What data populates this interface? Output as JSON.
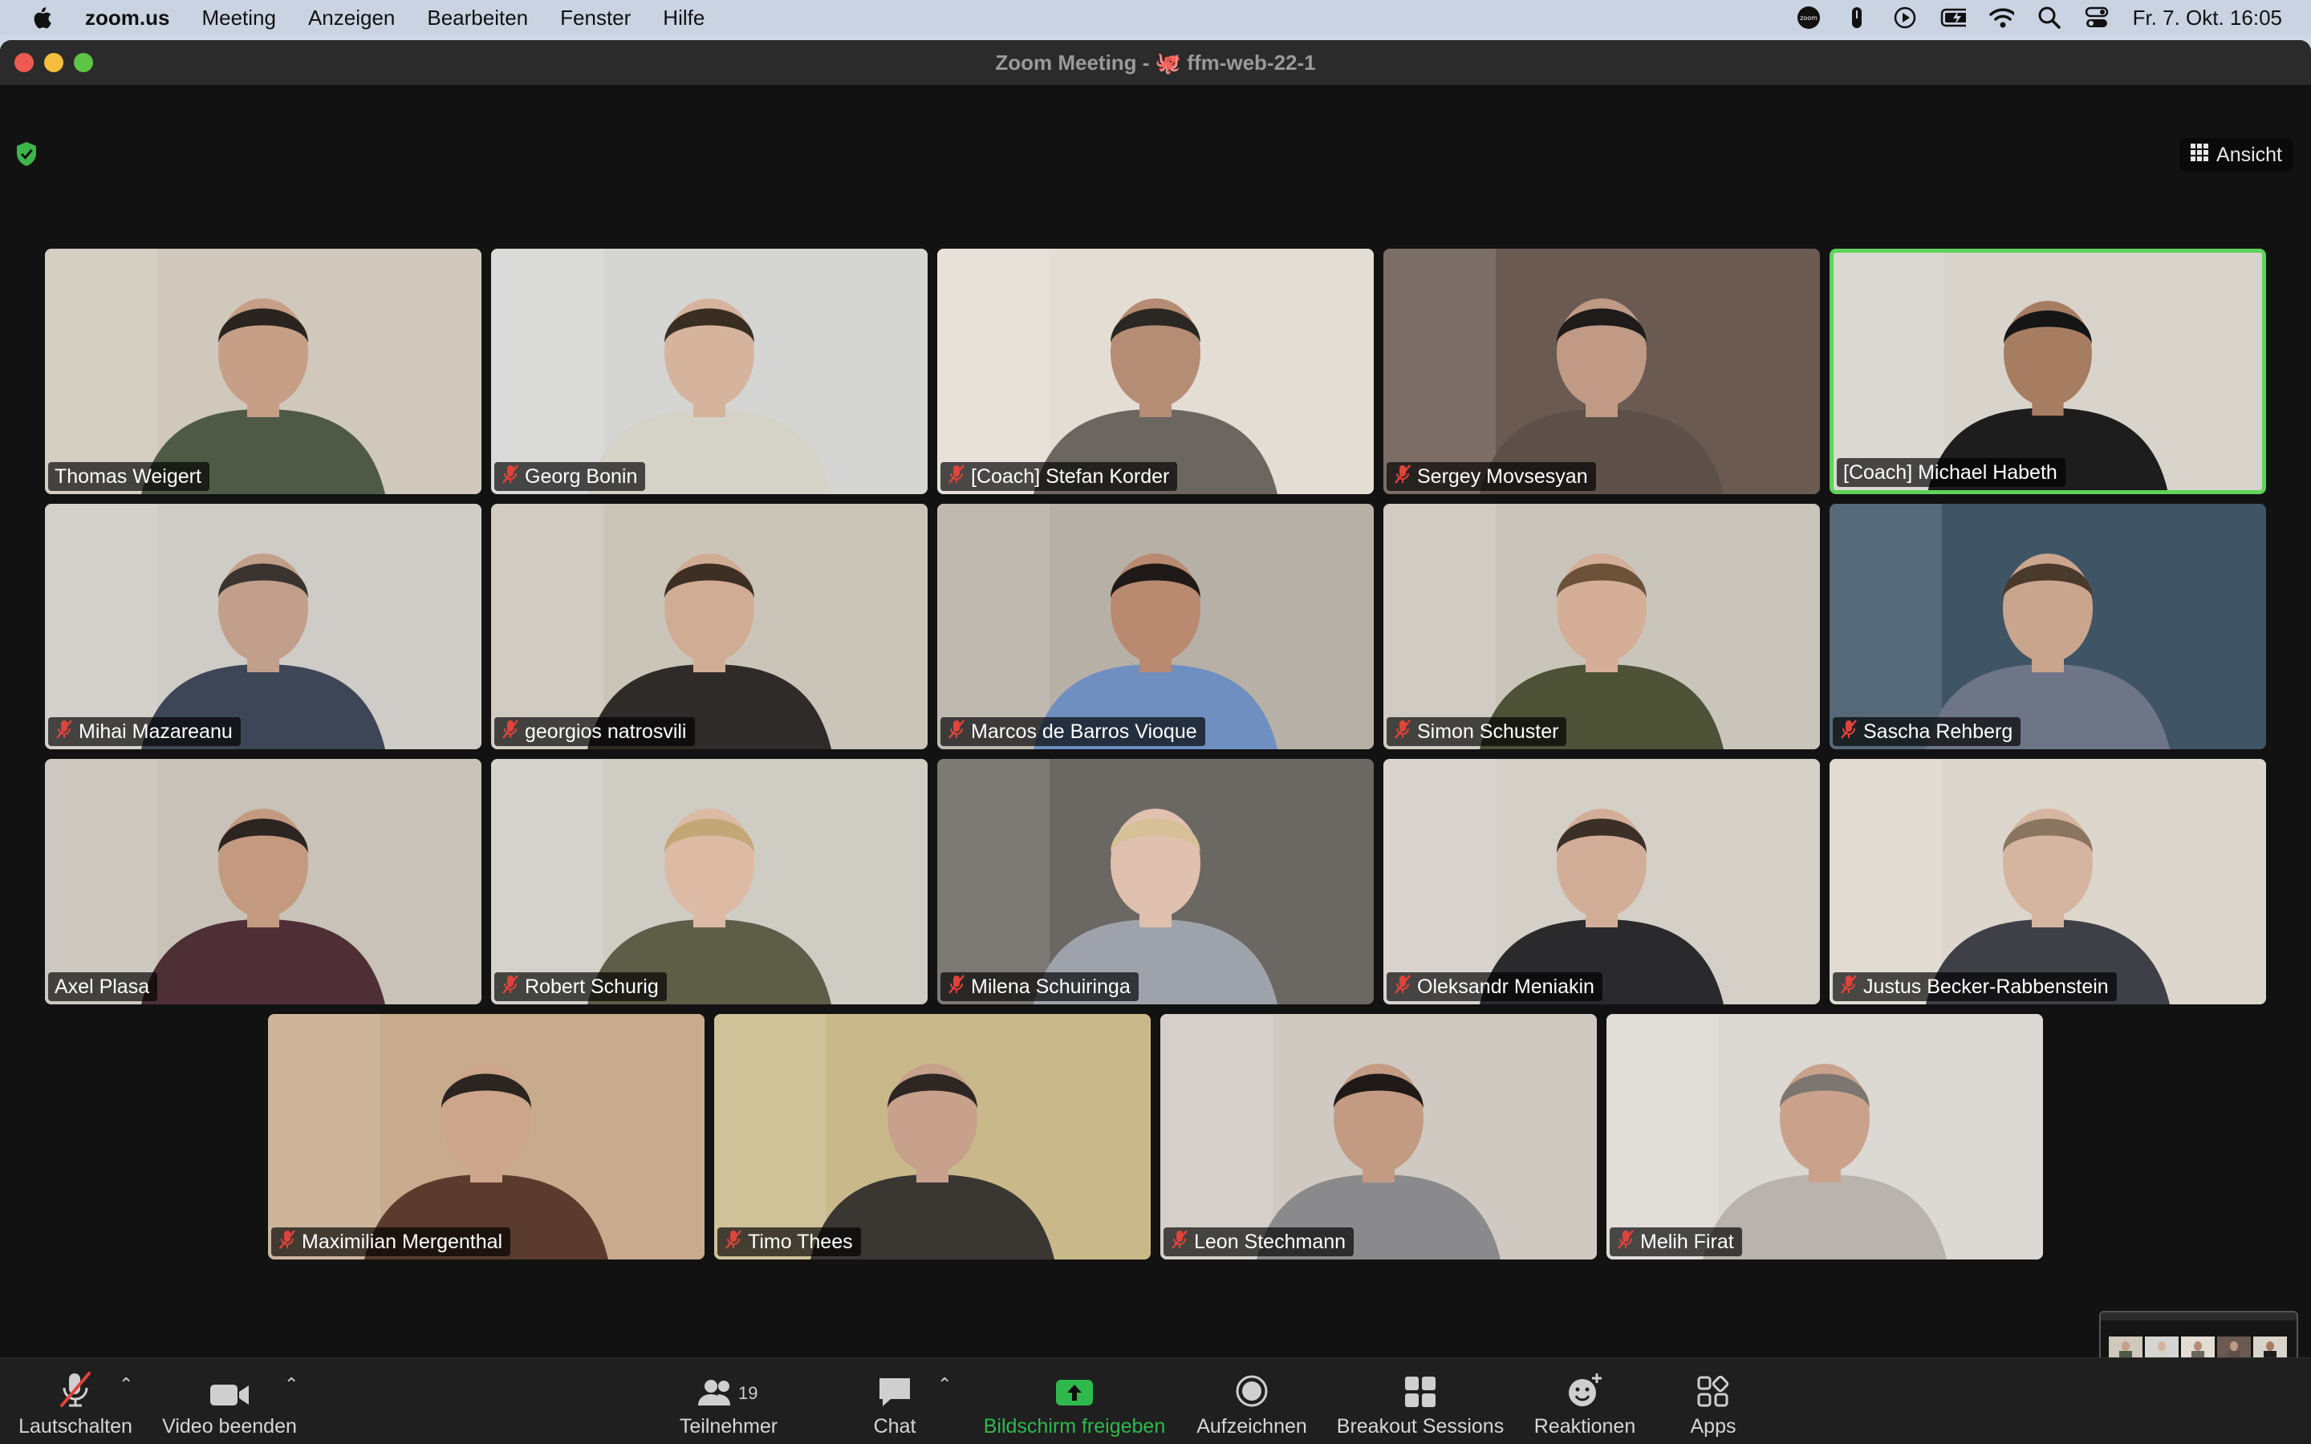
{
  "menubar": {
    "app_name": "zoom.us",
    "menus": [
      "Meeting",
      "Anzeigen",
      "Bearbeiten",
      "Fenster",
      "Hilfe"
    ],
    "clock": "Fr. 7. Okt. 16:05",
    "status_icons": [
      "zoom-status-icon",
      "gpu-icon",
      "play-icon",
      "battery-icon",
      "wifi-icon",
      "spotlight-search-icon",
      "control-center-icon"
    ]
  },
  "window": {
    "title_prefix": "Zoom Meeting - ",
    "title_emoji": "🐙",
    "title_name": "ffm-web-22-1"
  },
  "view_button": {
    "label": "Ansicht"
  },
  "colors": {
    "active_speaker_border": "#5fd35a",
    "share_green": "#2fb94d",
    "mute_red": "#e0433a"
  },
  "participants": [
    {
      "name": "Thomas Weigert",
      "muted": false,
      "bg": "#cfc8bb",
      "skin": "#c79f86",
      "shirt": "#4e5a45",
      "hair": "#2a2420"
    },
    {
      "name": "Georg Bonin",
      "muted": true,
      "bg": "#d5d5d3",
      "skin": "#d6b39c",
      "shirt": "#d5d2c7",
      "hair": "#3a2d22"
    },
    {
      "name": "[Coach] Stefan Korder",
      "muted": true,
      "bg": "#e4ddd4",
      "skin": "#b58c74",
      "shirt": "#6c6660",
      "hair": "#2b2722"
    },
    {
      "name": "Sergey Movsesyan",
      "muted": true,
      "bg": "#6a5a52",
      "skin": "#c09a85",
      "shirt": "#5c5048",
      "hair": "#1e1b1a"
    },
    {
      "name": "[Coach] Michael Habeth",
      "muted": false,
      "bg": "#d8d4cc",
      "skin": "#a77d62",
      "shirt": "#1d1d1d",
      "hair": "#151515"
    },
    {
      "name": "Mihai Mazareanu",
      "muted": true,
      "bg": "#cfcbc6",
      "skin": "#c29f8a",
      "shirt": "#3d4656",
      "hair": "#3a3330"
    },
    {
      "name": "georgios natrosvili",
      "muted": true,
      "bg": "#cbc4b9",
      "skin": "#d1ac94",
      "shirt": "#2f2b29",
      "hair": "#3e2f25"
    },
    {
      "name": "Marcos de Barros Vioque",
      "muted": true,
      "bg": "#b7b0a7",
      "skin": "#b98a70",
      "shirt": "#6f8fc0",
      "hair": "#1f1a17"
    },
    {
      "name": "Simon Schuster",
      "muted": true,
      "bg": "#cac5bb",
      "skin": "#d5ae98",
      "shirt": "#4d5237",
      "hair": "#6b5238"
    },
    {
      "name": "Sascha Rehberg",
      "muted": true,
      "bg": "#3f5566",
      "skin": "#caa58e",
      "shirt": "#6d7586",
      "hair": "#4a3a2c"
    },
    {
      "name": "Axel Plasa",
      "muted": false,
      "bg": "#c8c2b8",
      "skin": "#c39a80",
      "shirt": "#4e2f36",
      "hair": "#2c2420"
    },
    {
      "name": "Robert Schurig",
      "muted": true,
      "bg": "#cfccc4",
      "skin": "#ddbaa4",
      "shirt": "#5e5e48",
      "hair": "#c4a776"
    },
    {
      "name": "Milena Schuiringa",
      "muted": true,
      "bg": "#6b6762",
      "skin": "#e0c0ae",
      "shirt": "#9ea3ab",
      "hair": "#d6c097"
    },
    {
      "name": "Oleksandr Meniakin",
      "muted": true,
      "bg": "#d4cfc7",
      "skin": "#d2ae98",
      "shirt": "#2a2a2d",
      "hair": "#3b2f27"
    },
    {
      "name": "Justus Becker-Rabbenstein",
      "muted": true,
      "bg": "#ddd6cc",
      "skin": "#d6b5a0",
      "shirt": "#3f4047",
      "hair": "#8a7560"
    },
    {
      "name": "Maximilian Mergenthal",
      "muted": true,
      "bg": "#c8ab8c",
      "skin": "#cca58a",
      "shirt": "#5a3b2e",
      "hair": "#2b2420"
    },
    {
      "name": "Timo Thees",
      "muted": true,
      "bg": "#c9b98a",
      "skin": "#c7a18b",
      "shirt": "#3a3733",
      "hair": "#2e2622"
    },
    {
      "name": "Leon Stechmann",
      "muted": true,
      "bg": "#cfc9c1",
      "skin": "#c39b83",
      "shirt": "#8a8a8c",
      "hair": "#1f1a17"
    },
    {
      "name": "Melih Firat",
      "muted": true,
      "bg": "#dcd8d3",
      "skin": "#caa28b",
      "shirt": "#b8b3ad",
      "hair": "#7d7670"
    }
  ],
  "toolbar": {
    "mute_label": "Lautschalten",
    "video_label": "Video beenden",
    "participants_label": "Teilnehmer",
    "participants_count": "19",
    "chat_label": "Chat",
    "share_label": "Bildschirm freigeben",
    "record_label": "Aufzeichnen",
    "breakout_label": "Breakout Sessions",
    "reactions_label": "Reaktionen",
    "apps_label": "Apps"
  }
}
